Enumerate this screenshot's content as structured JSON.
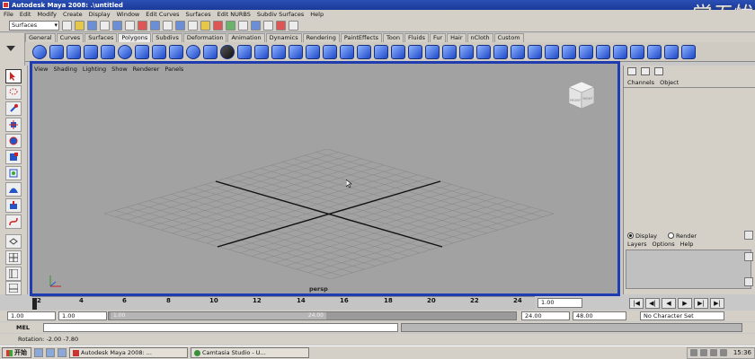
{
  "window": {
    "title": "Autodesk Maya 2008: .\\untitled"
  },
  "watermark": "学无忧",
  "menus": [
    "File",
    "Edit",
    "Modify",
    "Create",
    "Display",
    "Window",
    "Edit Curves",
    "Surfaces",
    "Edit NURBS",
    "Subdiv Surfaces",
    "Help"
  ],
  "status_line": {
    "menu_set": "Surfaces"
  },
  "shelf": {
    "tabs": [
      "General",
      "Curves",
      "Surfaces",
      "Polygons",
      "Subdivs",
      "Deformation",
      "Animation",
      "Dynamics",
      "Rendering",
      "PaintEffects",
      "Toon",
      "Fluids",
      "Fur",
      "Hair",
      "nCloth",
      "Custom"
    ],
    "active_tab": "Polygons"
  },
  "panel_menu": [
    "View",
    "Shading",
    "Lighting",
    "Show",
    "Renderer",
    "Panels"
  ],
  "viewport": {
    "camera_label": "persp",
    "view_cube_labels": [
      "FRONT",
      "RIGHT"
    ]
  },
  "channel_box": {
    "menu": [
      "Channels",
      "Object"
    ],
    "layer_mode": {
      "display": "Display",
      "render": "Render",
      "selected": "Display"
    },
    "layer_menu": [
      "Layers",
      "Options",
      "Help"
    ]
  },
  "time_slider": {
    "ticks": [
      "2",
      "4",
      "6",
      "8",
      "10",
      "12",
      "14",
      "16",
      "18",
      "20",
      "22",
      "24"
    ],
    "current_time": "1.00"
  },
  "playback_controls": [
    "|◀",
    "◀|",
    "◀",
    "▶",
    "▶|",
    "▶|"
  ],
  "range_slider": {
    "start_time": "1.00",
    "playback_start": "1.00",
    "handle_left": "1.00",
    "handle_right": "24.00",
    "playback_end": "24.00",
    "end_time": "48.00",
    "character_set": "No Character Set"
  },
  "command_line": {
    "label": "MEL",
    "value": "",
    "result": ""
  },
  "help_line": {
    "text": "Rotation: -2.00    -7.80"
  },
  "taskbar": {
    "start": "开始",
    "tasks": [
      "Autodesk Maya 2008: ...",
      "Camtasia Studio - U..."
    ],
    "clock": "15:36"
  }
}
